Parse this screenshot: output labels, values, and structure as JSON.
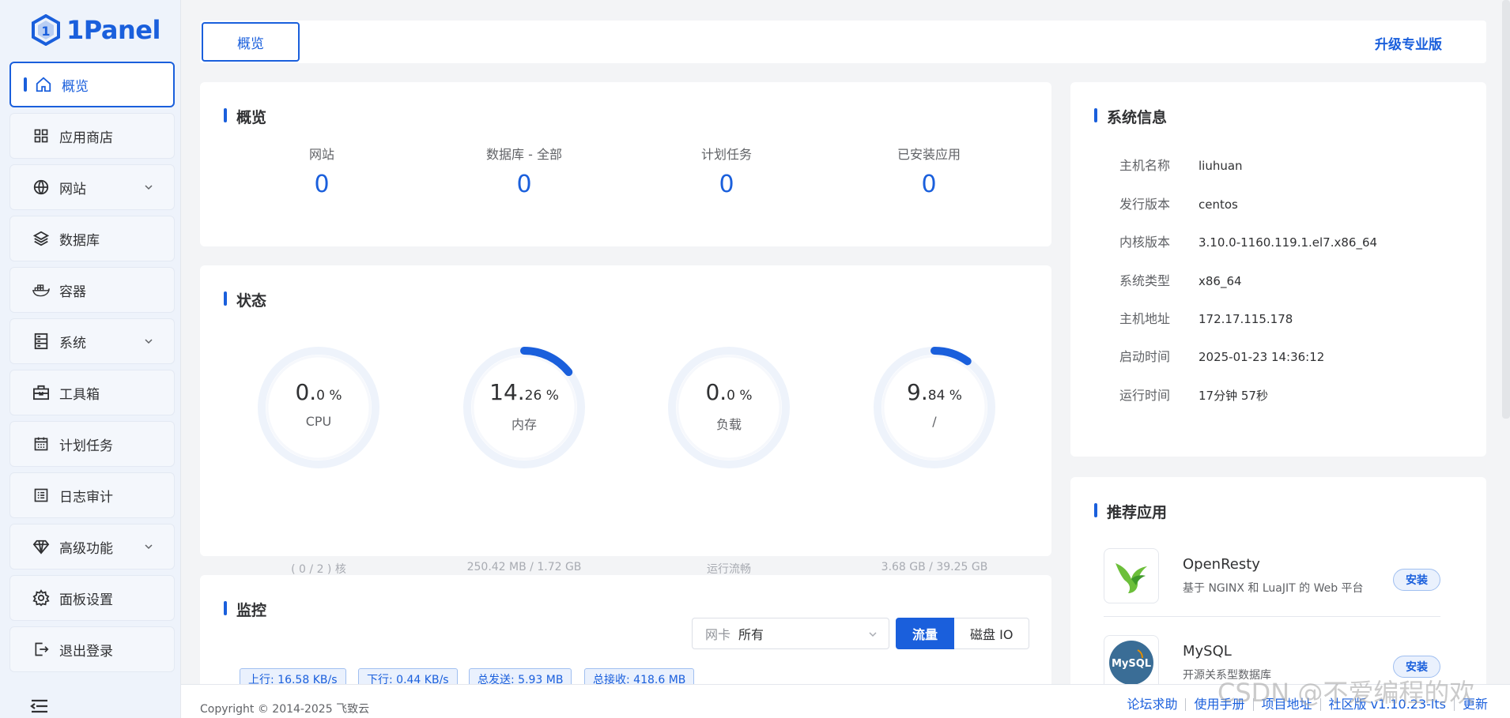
{
  "app": {
    "logo_text": "1Panel"
  },
  "sidebar": {
    "items": [
      {
        "label": "概览",
        "icon": "home-icon",
        "active": true
      },
      {
        "label": "应用商店",
        "icon": "grid-icon"
      },
      {
        "label": "网站",
        "icon": "globe-icon",
        "expandable": true
      },
      {
        "label": "数据库",
        "icon": "layers-icon"
      },
      {
        "label": "容器",
        "icon": "docker-icon"
      },
      {
        "label": "系统",
        "icon": "server-icon",
        "expandable": true
      },
      {
        "label": "工具箱",
        "icon": "toolbox-icon"
      },
      {
        "label": "计划任务",
        "icon": "calendar-icon"
      },
      {
        "label": "日志审计",
        "icon": "log-icon"
      },
      {
        "label": "高级功能",
        "icon": "diamond-icon",
        "expandable": true
      },
      {
        "label": "面板设置",
        "icon": "gear-icon"
      },
      {
        "label": "退出登录",
        "icon": "logout-icon"
      }
    ]
  },
  "topbar": {
    "tab": "概览",
    "upgrade": "升级专业版"
  },
  "overview": {
    "title": "概览",
    "stats": [
      {
        "label": "网站",
        "value": "0"
      },
      {
        "label": "数据库 - 全部",
        "value": "0"
      },
      {
        "label": "计划任务",
        "value": "0"
      },
      {
        "label": "已安装应用",
        "value": "0"
      }
    ]
  },
  "status": {
    "title": "状态",
    "gauges": [
      {
        "int": "0.",
        "dec": "0 %",
        "name": "CPU",
        "sub": "( 0 / 2 ) 核",
        "percent": 0
      },
      {
        "int": "14.",
        "dec": "26 %",
        "name": "内存",
        "sub": "250.42 MB / 1.72 GB",
        "percent": 14.26
      },
      {
        "int": "0.",
        "dec": "0 %",
        "name": "负载",
        "sub": "运行流畅",
        "percent": 0
      },
      {
        "int": "9.",
        "dec": "84 %",
        "name": "/",
        "sub": "3.68 GB / 39.25 GB",
        "percent": 9.84
      }
    ]
  },
  "monitor": {
    "title": "监控",
    "nic_prefix": "网卡",
    "nic_value": "所有",
    "seg_traffic": "流量",
    "seg_disk": "磁盘 IO",
    "tags": [
      "上行: 16.58 KB/s",
      "下行: 0.44 KB/s",
      "总发送: 5.93 MB",
      "总接收: 418.6 MB"
    ]
  },
  "sysinfo": {
    "title": "系统信息",
    "rows": [
      {
        "key": "主机名称",
        "value": "liuhuan"
      },
      {
        "key": "发行版本",
        "value": "centos"
      },
      {
        "key": "内核版本",
        "value": "3.10.0-1160.119.1.el7.x86_64"
      },
      {
        "key": "系统类型",
        "value": "x86_64"
      },
      {
        "key": "主机地址",
        "value": "172.17.115.178"
      },
      {
        "key": "启动时间",
        "value": "2025-01-23 14:36:12"
      },
      {
        "key": "运行时间",
        "value": "17分钟 57秒"
      }
    ]
  },
  "apps": {
    "title": "推荐应用",
    "list": [
      {
        "name": "OpenResty",
        "desc": "基于 NGINX 和 LuaJIT 的 Web 平台",
        "button": "安装",
        "logo": "openresty-logo-icon"
      },
      {
        "name": "MySQL",
        "desc": "开源关系型数据库",
        "button": "安装",
        "logo": "mysql-logo-icon",
        "logo_text": "MySQL"
      }
    ]
  },
  "footer": {
    "copyright": "Copyright © 2014-2025 飞致云",
    "links": [
      "论坛求助",
      "使用手册",
      "项目地址",
      "社区版 v1.10.23-lts",
      "更新"
    ]
  },
  "watermark": "CSDN @不爱编程的欢",
  "colors": {
    "accent": "#1a5fdc",
    "track": "#eef3fb"
  }
}
